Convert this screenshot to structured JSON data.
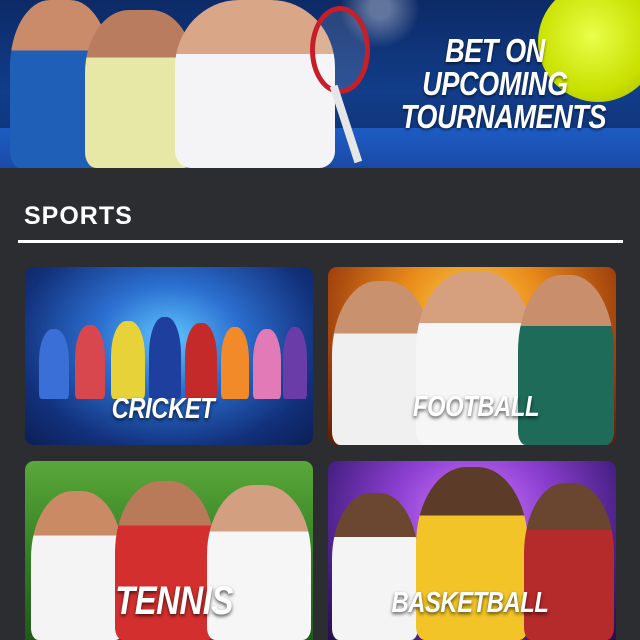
{
  "banner": {
    "headline_lines": [
      "BET ON",
      "UPCOMING",
      "TOURNAMENTS"
    ]
  },
  "sports_section": {
    "title": "SPORTS",
    "cards": [
      {
        "label": "CRICKET"
      },
      {
        "label": "FOOTBALL"
      },
      {
        "label": "TENNIS"
      },
      {
        "label": "BASKETBALL"
      }
    ]
  },
  "colors": {
    "page_background": "#2b2d30",
    "banner_blue": "#123d8a",
    "tennis_ball": "#c9e000",
    "text": "#ffffff"
  }
}
